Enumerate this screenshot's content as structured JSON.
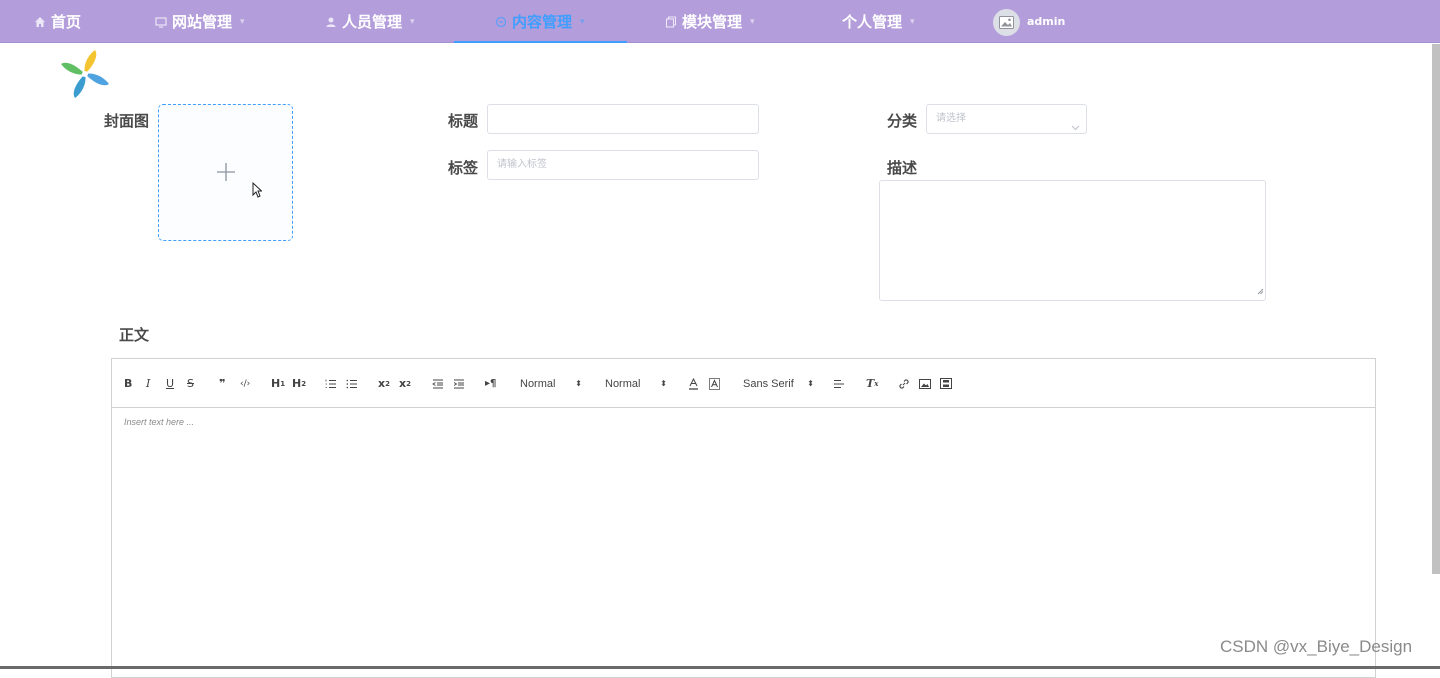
{
  "nav": {
    "home": "首页",
    "website": "网站管理",
    "people": "人员管理",
    "content": "内容管理",
    "module": "模块管理",
    "personal": "个人管理",
    "user": "admin"
  },
  "colors": {
    "nav_bg": "#b39ddb",
    "accent": "#409eff"
  },
  "form": {
    "cover_label": "封面图",
    "title_label": "标题",
    "title_value": "",
    "tag_label": "标签",
    "tag_placeholder": "请输入标签",
    "category_label": "分类",
    "category_placeholder": "请选择",
    "desc_label": "描述",
    "body_label": "正文"
  },
  "editor": {
    "header_picker": "Normal",
    "size_picker": "Normal",
    "font_picker": "Sans Serif",
    "placeholder": "Insert text here ..."
  },
  "watermark": "CSDN @vx_Biye_Design"
}
